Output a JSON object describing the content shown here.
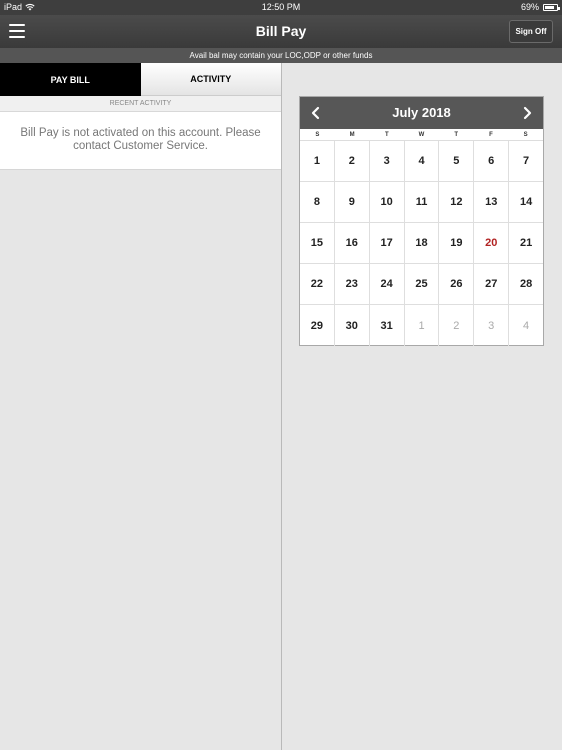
{
  "status_bar": {
    "device": "iPad",
    "time": "12:50 PM",
    "battery": "69%",
    "battery_level": 0.69
  },
  "nav": {
    "title": "Bill Pay",
    "signoff_label": "Sign Off"
  },
  "notice": "Avail bal may contain your LOC,ODP or other funds",
  "tabs": {
    "pay_bill": "PAY BILL",
    "activity": "ACTIVITY"
  },
  "recent_activity": {
    "header": "RECENT ACTIVITY",
    "message": "Bill Pay is not activated on this account. Please contact Customer Service."
  },
  "calendar": {
    "month_title": "July 2018",
    "weekdays": [
      "S",
      "M",
      "T",
      "W",
      "T",
      "F",
      "S"
    ],
    "today": 20,
    "weeks": [
      [
        {
          "d": "1"
        },
        {
          "d": "2"
        },
        {
          "d": "3"
        },
        {
          "d": "4"
        },
        {
          "d": "5"
        },
        {
          "d": "6"
        },
        {
          "d": "7"
        }
      ],
      [
        {
          "d": "8"
        },
        {
          "d": "9"
        },
        {
          "d": "10"
        },
        {
          "d": "11"
        },
        {
          "d": "12"
        },
        {
          "d": "13"
        },
        {
          "d": "14"
        }
      ],
      [
        {
          "d": "15"
        },
        {
          "d": "16"
        },
        {
          "d": "17"
        },
        {
          "d": "18"
        },
        {
          "d": "19"
        },
        {
          "d": "20",
          "today": true
        },
        {
          "d": "21"
        }
      ],
      [
        {
          "d": "22"
        },
        {
          "d": "23"
        },
        {
          "d": "24"
        },
        {
          "d": "25"
        },
        {
          "d": "26"
        },
        {
          "d": "27"
        },
        {
          "d": "28"
        }
      ],
      [
        {
          "d": "29"
        },
        {
          "d": "30"
        },
        {
          "d": "31"
        },
        {
          "d": "1",
          "other": true
        },
        {
          "d": "2",
          "other": true
        },
        {
          "d": "3",
          "other": true
        },
        {
          "d": "4",
          "other": true
        }
      ]
    ]
  },
  "colors": {
    "today": "#b22222",
    "header": "#575757",
    "active_tab": "#000000"
  }
}
